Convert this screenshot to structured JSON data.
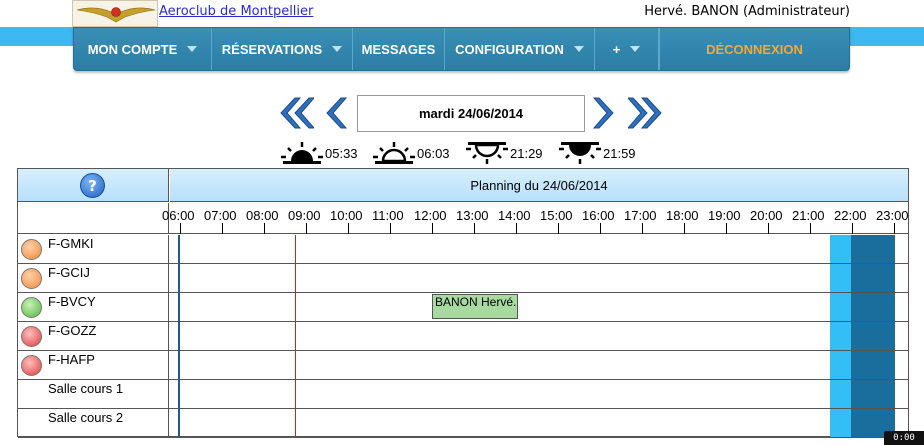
{
  "header": {
    "site_name": "Aeroclub de Montpellier",
    "logo_text": "Aéroclub de Montpellier",
    "user": "Hervé. BANON (Administrateur)"
  },
  "nav": {
    "items": [
      {
        "label": "MON COMPTE",
        "dropdown": true
      },
      {
        "label": "RÉSERVATIONS",
        "dropdown": true
      },
      {
        "label": "MESSAGES",
        "dropdown": false
      },
      {
        "label": "CONFIGURATION",
        "dropdown": true
      },
      {
        "label": "+",
        "dropdown": true
      }
    ],
    "logout": "DÉCONNEXION"
  },
  "date_nav": {
    "date": "mardi 24/06/2014"
  },
  "sun_times": [
    {
      "icon": "sunrise-dawn-icon",
      "time": "05:33"
    },
    {
      "icon": "sunrise-icon",
      "time": "06:03"
    },
    {
      "icon": "sunset-icon",
      "time": "21:29"
    },
    {
      "icon": "sunset-dusk-icon",
      "time": "21:59"
    }
  ],
  "planning": {
    "help": "?",
    "title": "Planning du 24/06/2014",
    "hours": [
      "06:00",
      "07:00",
      "08:00",
      "09:00",
      "10:00",
      "11:00",
      "12:00",
      "13:00",
      "14:00",
      "15:00",
      "16:00",
      "17:00",
      "18:00",
      "19:00",
      "20:00",
      "21:00",
      "22:00",
      "23:00"
    ],
    "resources": [
      {
        "name": "F-GMKI",
        "status": "orange"
      },
      {
        "name": "F-GCIJ",
        "status": "orange"
      },
      {
        "name": "F-BVCY",
        "status": "green"
      },
      {
        "name": "F-GOZZ",
        "status": "red"
      },
      {
        "name": "F-HAFP",
        "status": "red"
      },
      {
        "name": "Salle cours 1",
        "status": "none"
      },
      {
        "name": "Salle cours 2",
        "status": "none"
      }
    ],
    "booking": {
      "label": "BANON Hervé.",
      "resource": "F-BVCY",
      "start": "12:00",
      "end": "14:00"
    }
  },
  "colors": {
    "header_bg": "#3db8f0",
    "nav_bg": "#2b7da4",
    "logout": "#f2a93a",
    "arrow": "#2f6fc0",
    "booking": "#a8d9a0",
    "dusk": "#33bff5",
    "night": "#1a6e9e",
    "now_line": "#d02020"
  },
  "clock": "0:00"
}
